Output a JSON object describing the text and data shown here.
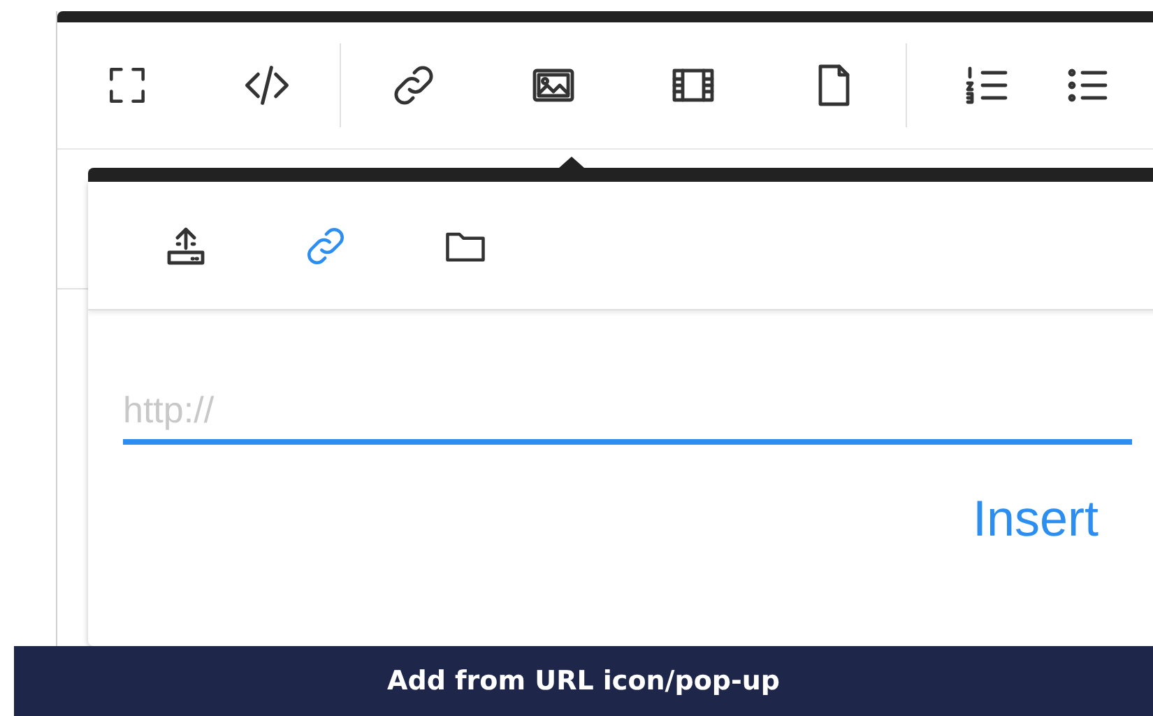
{
  "popup": {
    "tabs": [
      {
        "kind": "upload",
        "selected": false
      },
      {
        "kind": "link",
        "selected": true
      },
      {
        "kind": "folder",
        "selected": false
      }
    ],
    "url_field": {
      "placeholder": "http://",
      "focused": true
    },
    "insert_button": "Insert"
  },
  "caption": "Add from URL icon/pop-up"
}
